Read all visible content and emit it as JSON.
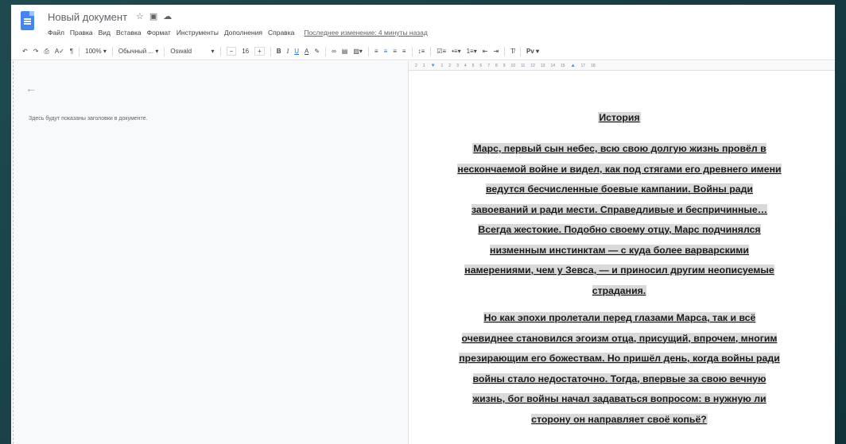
{
  "header": {
    "title": "Новый документ",
    "icons": [
      "star-icon",
      "folder-move-icon",
      "cloud-status-icon"
    ]
  },
  "menu": {
    "items": [
      "Файл",
      "Правка",
      "Вид",
      "Вставка",
      "Формат",
      "Инструменты",
      "Дополнения",
      "Справка"
    ],
    "last_edit": "Последнее изменение: 4 минуты назад"
  },
  "toolbar": {
    "zoom": "100%",
    "style": "Обычный ...",
    "font": "Oswald",
    "font_size": "16",
    "minus": "−",
    "plus": "+",
    "bold": "B",
    "italic": "I",
    "underline": "U",
    "text_color": "A",
    "input_tools": "Pv"
  },
  "ruler": {
    "ticks": [
      "2",
      "1",
      "1",
      "2",
      "3",
      "4",
      "5",
      "6",
      "7",
      "8",
      "9",
      "10",
      "11",
      "12",
      "13",
      "14",
      "15",
      "17",
      "18"
    ]
  },
  "outline": {
    "hint": "Здесь будут показаны заголовки в документе."
  },
  "document": {
    "heading": "История",
    "paragraph1": "Марс, первый сын небес, всю свою долгую жизнь провёл в нескончаемой войне и видел, как под стягами его древнего имени ведутся бесчисленные боевые кампании. Войны ради завоеваний и ради мести. Справедливые и беспричинные… Всегда жестокие. Подобно своему отцу, Марс подчинялся низменным инстинктам — с куда более варварскими намерениями, чем у Зевса, — и приносил другим неописуемые страдания.",
    "paragraph2": "Но как эпохи пролетали перед глазами Марса, так и всё очевиднее становился эгоизм отца, присущий, впрочем, многим презирающим его божествам. Но пришёл день, когда войны ради войны стало недостаточно. Тогда, впервые за свою вечную жизнь, бог войны начал задаваться вопросом: в нужную ли сторону он направляет своё копьё?"
  },
  "colors": {
    "accent": "#1a73e8",
    "doc_icon": "#4285f4",
    "text_highlight": "#d9d9d9",
    "background_outer": "#1e4a4f"
  }
}
